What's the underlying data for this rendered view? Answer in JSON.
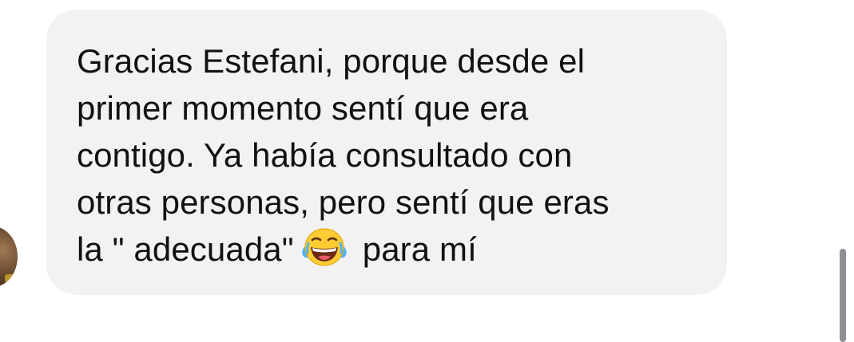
{
  "message": {
    "lines": [
      "Gracias Estefani, porque desde el",
      "primer momento sentí que era",
      "contigo. Ya había consultado con",
      "otras personas, pero sentí que eras"
    ],
    "last_line_before_emoji": "la \" adecuada\"",
    "emoji_name": "face-with-tears-of-joy-icon",
    "last_line_after_emoji": "para mí"
  },
  "colors": {
    "bubble_background": "#f2f2f4",
    "text": "#111111",
    "scrollbar": "#8e8e93"
  }
}
